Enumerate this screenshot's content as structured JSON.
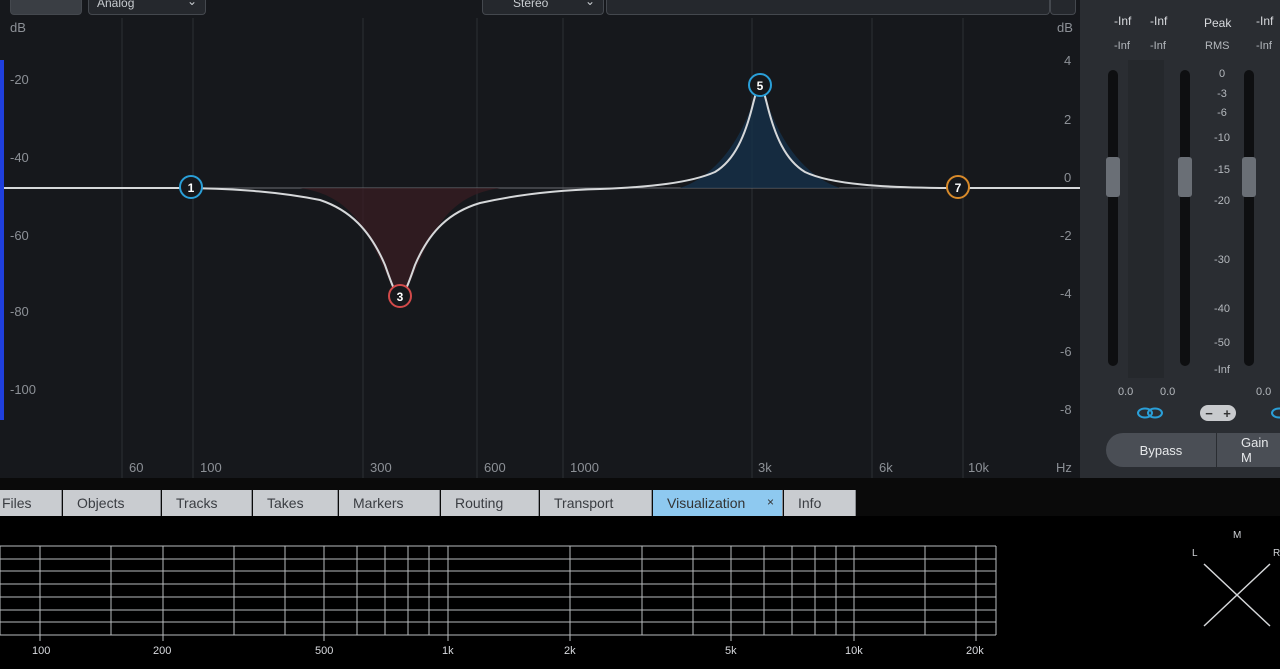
{
  "eq": {
    "model_dropdown": "Analog",
    "channel_dropdown": "Stereo",
    "db_label_left": "dB",
    "db_label_right": "dB",
    "hz_label": "Hz",
    "left_scale": [
      "-20",
      "-40",
      "-60",
      "-80",
      "-100"
    ],
    "right_scale": [
      "4",
      "2",
      "0",
      "-2",
      "-4",
      "-6",
      "-8"
    ],
    "freq_labels": [
      "60",
      "100",
      "300",
      "600",
      "1000",
      "3k",
      "6k",
      "10k"
    ],
    "nodes": [
      {
        "label": "1",
        "color": "#2a9fd8"
      },
      {
        "label": "3",
        "color": "#d24a4a"
      },
      {
        "label": "5",
        "color": "#2a9fd8"
      },
      {
        "label": "7",
        "color": "#d88a2a"
      }
    ]
  },
  "meter": {
    "peak_row": [
      "-Inf",
      "-Inf",
      "Peak",
      "-Inf"
    ],
    "rms_row": [
      "-Inf",
      "-Inf",
      "RMS",
      "-Inf"
    ],
    "scale": [
      "0",
      "-3",
      "-6",
      "-10",
      "-15",
      "-20",
      "-30",
      "-40",
      "-50",
      "-Inf"
    ],
    "readouts": [
      "0.0",
      "0.0",
      "0.0"
    ],
    "bypass_label": "Bypass",
    "gain_label": "Gain M"
  },
  "tabs": [
    {
      "label": "Files"
    },
    {
      "label": "Objects"
    },
    {
      "label": "Tracks"
    },
    {
      "label": "Takes"
    },
    {
      "label": "Markers"
    },
    {
      "label": "Routing"
    },
    {
      "label": "Transport"
    },
    {
      "label": "Visualization"
    },
    {
      "label": "Info"
    }
  ],
  "active_tab_close": "×",
  "viz": {
    "freq_labels": [
      "100",
      "200",
      "500",
      "1k",
      "2k",
      "5k",
      "10k",
      "20k"
    ],
    "goniometer": {
      "m": "M",
      "l": "L",
      "r": "R"
    }
  }
}
